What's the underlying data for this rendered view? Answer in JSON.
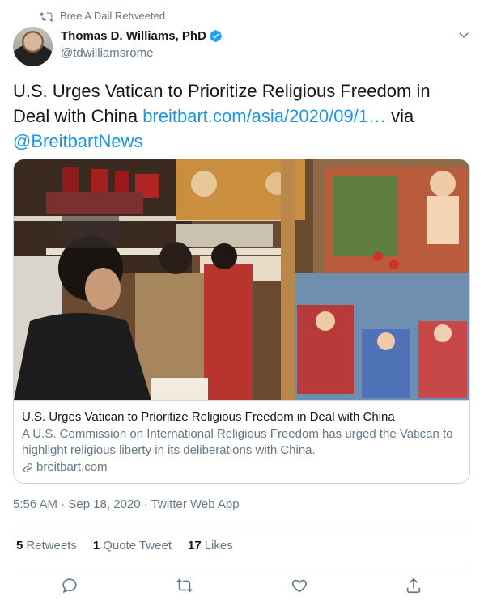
{
  "retweet_context": {
    "text": "Bree A Dail Retweeted"
  },
  "author": {
    "name": "Thomas D. Williams, PhD",
    "handle": "@tdwilliamsrome"
  },
  "tweet": {
    "text_main": "U.S. Urges Vatican to Prioritize Religious Freedom in Deal with China ",
    "link_text": "breitbart.com/asia/2020/09/1…",
    "via_text": " via ",
    "mention": "@BreitbartNews"
  },
  "card": {
    "title": "U.S. Urges Vatican to Prioritize Religious Freedom in Deal with China",
    "description": "A U.S. Commission on International Religious Freedom has urged the Vatican to highlight religious liberty in its deliberations with China.",
    "domain": "breitbart.com"
  },
  "meta": {
    "text": "5:56 AM · Sep 18, 2020 · Twitter Web App"
  },
  "stats": {
    "retweets_count": "5",
    "retweets_label": "Retweets",
    "quotes_count": "1",
    "quotes_label": "Quote Tweet",
    "likes_count": "17",
    "likes_label": "Likes"
  },
  "icons": [
    "retweet-icon",
    "verified-badge-icon",
    "chevron-down-icon",
    "link-icon",
    "reply-icon",
    "like-icon",
    "share-icon"
  ],
  "colors": {
    "link": "#1b95e0",
    "verified": "#1da1f2",
    "secondary_text": "#657786",
    "border": "#ccd6dd"
  }
}
